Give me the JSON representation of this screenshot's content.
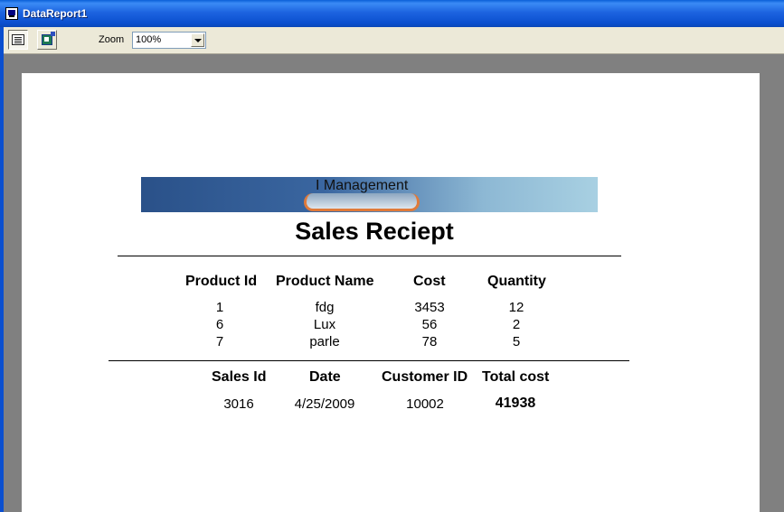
{
  "window": {
    "title": "DataReport1"
  },
  "toolbar": {
    "print_button": "print-icon",
    "export_button": "export-icon",
    "zoom_label": "Zoom",
    "zoom_value": "100%"
  },
  "report": {
    "banner_text": "I Management",
    "title": "Sales Reciept",
    "products_header": {
      "id": "Product Id",
      "name": "Product Name",
      "cost": "Cost",
      "qty": "Quantity"
    },
    "products": [
      {
        "id": "1",
        "name": "fdg",
        "cost": "3453",
        "qty": "12"
      },
      {
        "id": "6",
        "name": "Lux",
        "cost": "56",
        "qty": "2"
      },
      {
        "id": "7",
        "name": "parle",
        "cost": "78",
        "qty": "5"
      }
    ],
    "summary_header": {
      "sales_id": "Sales Id",
      "date": "Date",
      "customer_id": "Customer ID",
      "total": "Total cost"
    },
    "summary": {
      "sales_id": "3016",
      "date": "4/25/2009",
      "customer_id": "10002",
      "total": "41938"
    }
  }
}
